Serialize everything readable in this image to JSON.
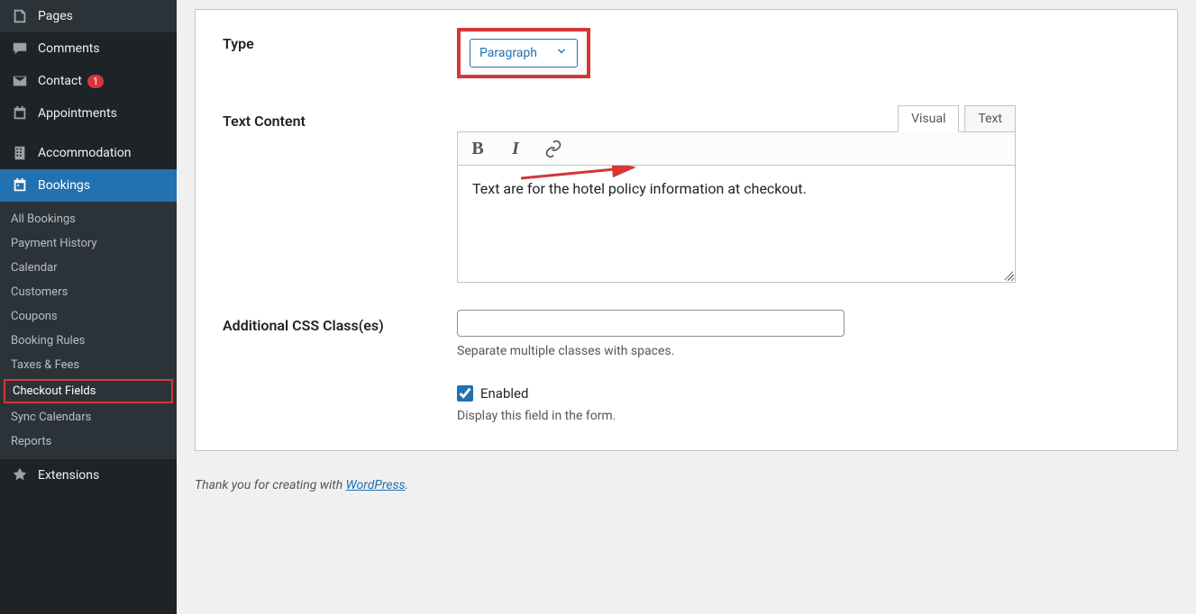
{
  "sidebar": {
    "items": [
      {
        "label": "Pages",
        "icon": "pages"
      },
      {
        "label": "Comments",
        "icon": "comments"
      },
      {
        "label": "Contact",
        "icon": "contact",
        "badge": "1"
      },
      {
        "label": "Appointments",
        "icon": "appointments"
      },
      {
        "label": "Accommodation",
        "icon": "accommodation"
      },
      {
        "label": "Bookings",
        "icon": "bookings",
        "active": true
      },
      {
        "label": "Extensions",
        "icon": "extensions"
      }
    ],
    "submenu": [
      {
        "label": "All Bookings"
      },
      {
        "label": "Payment History"
      },
      {
        "label": "Calendar"
      },
      {
        "label": "Customers"
      },
      {
        "label": "Coupons"
      },
      {
        "label": "Booking Rules"
      },
      {
        "label": "Taxes & Fees"
      },
      {
        "label": "Checkout Fields",
        "highlighted": true
      },
      {
        "label": "Sync Calendars"
      },
      {
        "label": "Reports"
      }
    ]
  },
  "form": {
    "type_label": "Type",
    "type_value": "Paragraph",
    "content_label": "Text Content",
    "tab_visual": "Visual",
    "tab_text": "Text",
    "editor_text": "Text are for the hotel policy information at checkout.",
    "css_label": "Additional CSS Class(es)",
    "css_help": "Separate multiple classes with spaces.",
    "enabled_label": "Enabled",
    "enabled_help": "Display this field in the form."
  },
  "footer": {
    "prefix": "Thank you for creating with ",
    "link": "WordPress",
    "suffix": "."
  }
}
